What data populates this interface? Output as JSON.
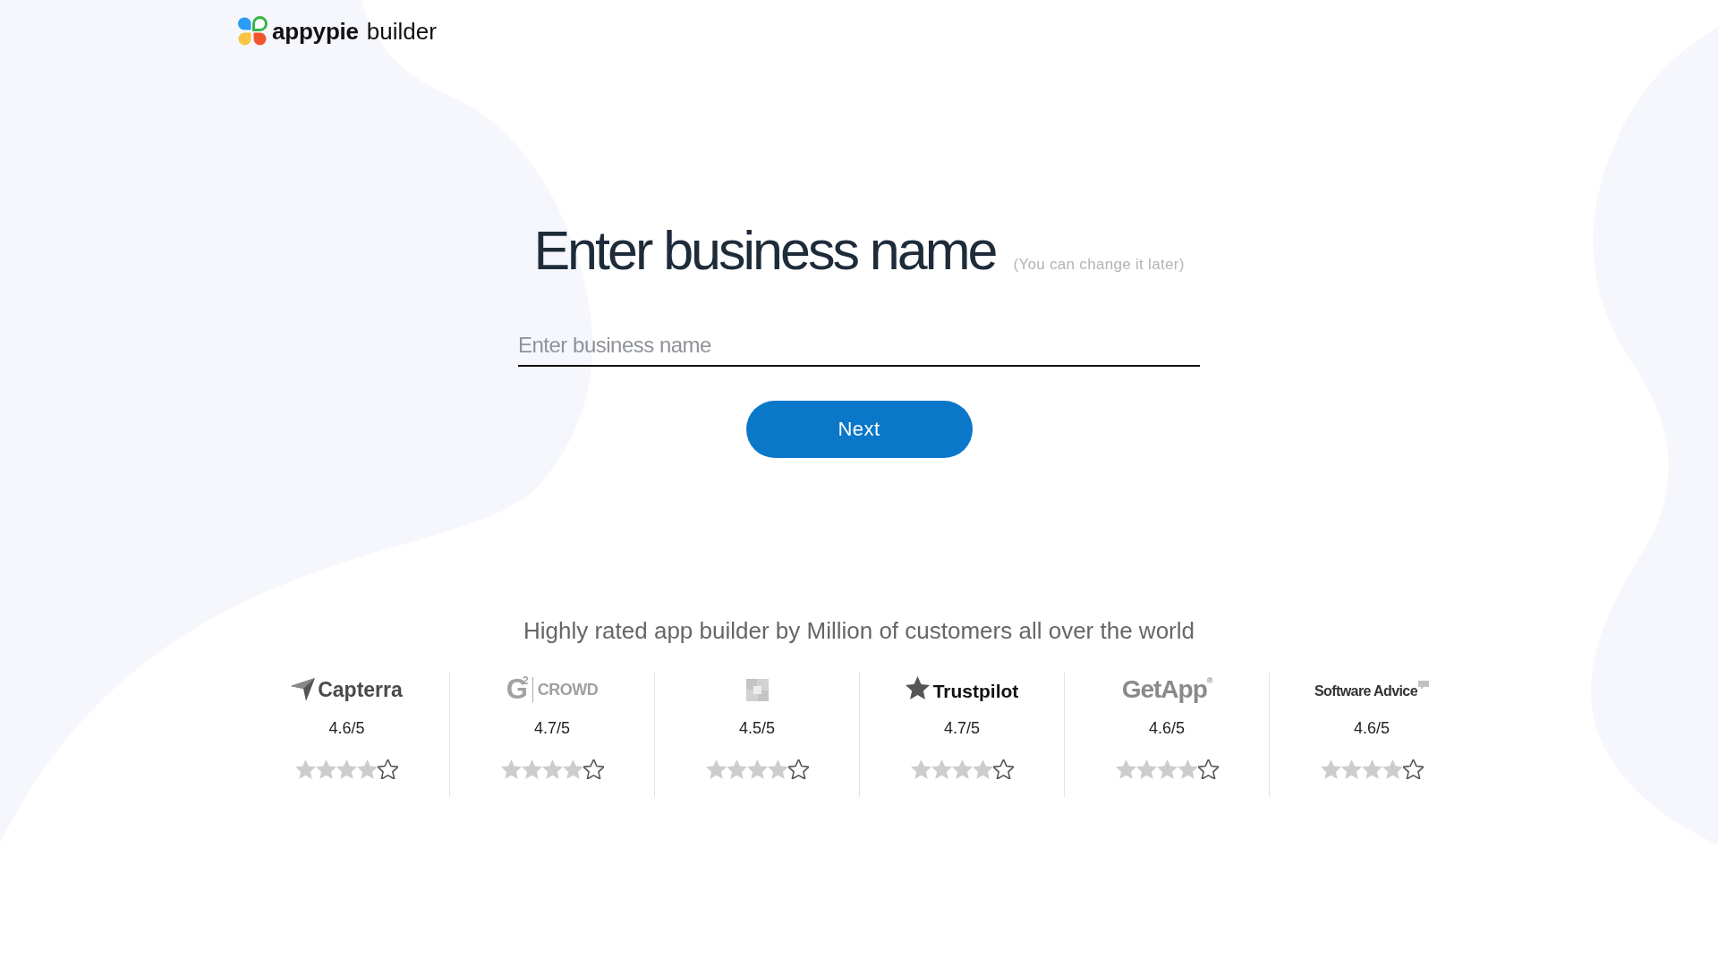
{
  "header": {
    "logo": {
      "brand": "appypie",
      "product": "builder"
    }
  },
  "form": {
    "title": "Enter business name",
    "hint": "(You can change it later)",
    "business_name": {
      "placeholder": "Enter business name"
    },
    "next_button": "Next"
  },
  "ratings": {
    "tagline": "Highly rated app builder by Million of customers all over the world",
    "sites": [
      {
        "kind": "arrow",
        "name": "Capterra",
        "rating": "4.6/5",
        "stars": 4
      },
      {
        "kind": "mark",
        "mark": "G$^{2}$",
        "name": "CROWD",
        "rating": "4.7/5",
        "stars": 4
      },
      {
        "kind": "tiles",
        "rating": "4.5/5",
        "stars": 4
      },
      {
        "kind": "star",
        "name": "Trustpilot",
        "rating": "4.7/5",
        "stars": 4
      },
      {
        "kind": "word",
        "name": "GetApp$^{®}$",
        "rating": "4.6/5",
        "stars": 4
      },
      {
        "kind": "bubble",
        "name": "Software Advice",
        "rating": "4.6/5",
        "stars": 4
      }
    ]
  }
}
